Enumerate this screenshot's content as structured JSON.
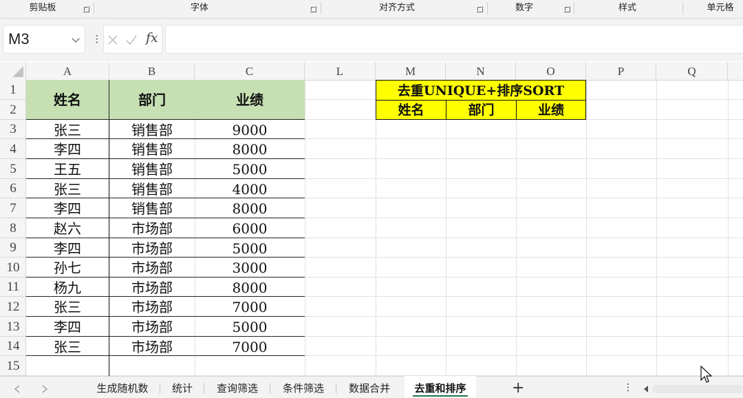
{
  "ribbon": {
    "groups": [
      "剪贴板",
      "字体",
      "对齐方式",
      "数字",
      "样式",
      "单元格"
    ]
  },
  "formula_bar": {
    "name_box": "M3",
    "fx_label": "fx",
    "formula": ""
  },
  "columns": [
    "A",
    "B",
    "C",
    "L",
    "M",
    "N",
    "O",
    "P",
    "Q"
  ],
  "rows": [
    "1",
    "2",
    "3",
    "4",
    "5",
    "6",
    "7",
    "8",
    "9",
    "10",
    "11",
    "12",
    "13",
    "14",
    "15"
  ],
  "source_table": {
    "headers": [
      "姓名",
      "部门",
      "业绩"
    ],
    "rows": [
      [
        "张三",
        "销售部",
        "9000"
      ],
      [
        "李四",
        "销售部",
        "8000"
      ],
      [
        "王五",
        "销售部",
        "5000"
      ],
      [
        "张三",
        "销售部",
        "4000"
      ],
      [
        "李四",
        "销售部",
        "8000"
      ],
      [
        "赵六",
        "市场部",
        "6000"
      ],
      [
        "李四",
        "市场部",
        "5000"
      ],
      [
        "孙七",
        "市场部",
        "3000"
      ],
      [
        "杨九",
        "市场部",
        "8000"
      ],
      [
        "张三",
        "市场部",
        "7000"
      ],
      [
        "李四",
        "市场部",
        "5000"
      ],
      [
        "张三",
        "市场部",
        "7000"
      ]
    ]
  },
  "result_table": {
    "title": "去重UNIQUE+排序SORT",
    "headers": [
      "姓名",
      "部门",
      "业绩"
    ]
  },
  "sheet_tabs": {
    "tabs": [
      "生成随机数",
      "统计",
      "查询筛选",
      "条件筛选",
      "数据合并",
      "去重和排序"
    ],
    "active": "去重和排序",
    "add_label": "+"
  },
  "colors": {
    "header_green": "#c6e0b4",
    "result_yellow": "#ffff00",
    "active_tab_underline": "#217346"
  }
}
